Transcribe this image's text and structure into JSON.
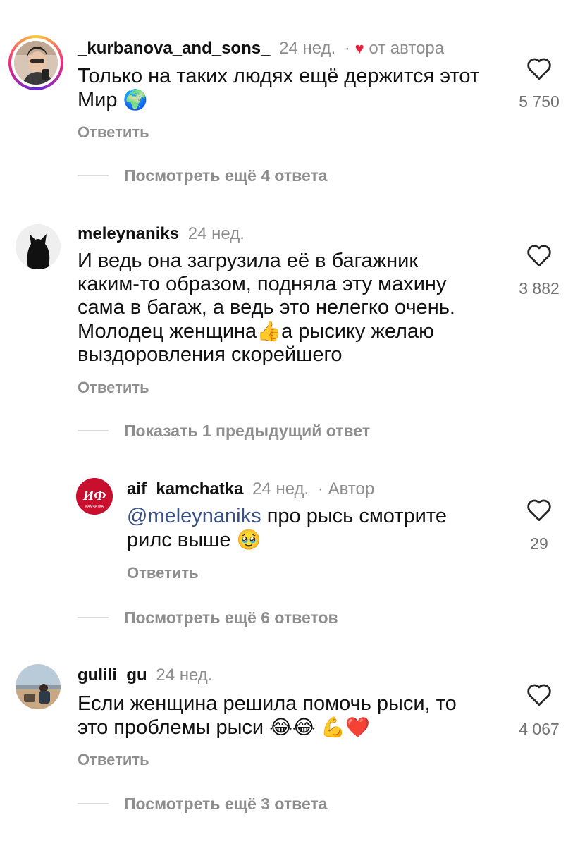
{
  "reply_label": "Ответить",
  "comments": [
    {
      "username": "_kurbanova_and_sons_",
      "time": "24 нед.",
      "separator": "·",
      "author_liked": "от автора",
      "text": "Только на таких людях ещё держится этот Мир",
      "emoji": "🌍",
      "likes": "5 750",
      "thread_link": "Посмотреть ещё 4 ответа"
    },
    {
      "username": "meleynaniks",
      "time": "24 нед.",
      "text_lines": [
        "И ведь она загрузила её в багажник",
        "каким-то образом, подняла эту махину",
        "сама в багаж, а ведь это нелегко очень.",
        "Молодец женщина",
        "а рысику желаю",
        "выздоровления скорейшего"
      ],
      "emoji": "👍",
      "likes": "3 882",
      "thread_link": "Показать 1 предыдущий ответ"
    },
    {
      "username": "aif_kamchatka",
      "time": "24 нед.",
      "separator": "·",
      "author_badge": "Автор",
      "avatar_text": "ИФ",
      "avatar_sub": "КАМЧАТКА",
      "mention": "@meleynaniks",
      "text_a": "про рысь смотрите",
      "text_b": "рилс выше",
      "emoji": "🥹",
      "likes": "29",
      "thread_link": "Посмотреть ещё 6 ответов"
    },
    {
      "username": "gulili_gu",
      "time": "24 нед.",
      "text_a": "Если женщина решила помочь рыси, то",
      "text_b": "это проблемы рыси",
      "emoji": "😂😂 💪❤️",
      "likes": "4 067",
      "thread_link": "Посмотреть ещё 3 ответа"
    }
  ],
  "colors": {
    "secondary_text": "#8e8e8e",
    "mention": "#385185",
    "heart": "#ed1c3a",
    "aif_red": "#c8102e"
  },
  "icons": [
    "heart-outline-icon",
    "heart-filled-icon"
  ]
}
